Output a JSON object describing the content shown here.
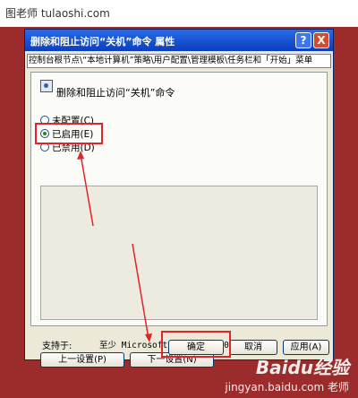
{
  "site_watermark": "图老师 tulaoshi.com",
  "dialog": {
    "title": "删除和阻止访问“关机”命令 属性",
    "help_label": "?",
    "close_label": "X",
    "path": "控制台根节点\\“本地计算机”策略\\用户配置\\管理模板\\任务栏和「开始」菜单",
    "policy_name": "删除和阻止访问“关机”命令",
    "options": [
      {
        "label": "未配置(C)",
        "selected": false
      },
      {
        "label": "已启用(E)",
        "selected": true
      },
      {
        "label": "已禁用(D)",
        "selected": false
      }
    ],
    "supported_label": "支持于:",
    "supported_value": "至少 Microsoft Windows 2000",
    "prev_label": "上一设置(P)",
    "next_label": "下一设置(N)",
    "ok_label": "确定",
    "cancel_label": "取消",
    "apply_label": "应用(A)"
  },
  "bottom_watermark": {
    "brand": "Baidu经验",
    "url": "jingyan.baidu.com",
    "corner": "老师"
  },
  "colors": {
    "background": "#9c2c2c",
    "highlight": "#e0242a",
    "titlebar": "#0a3fbf"
  }
}
